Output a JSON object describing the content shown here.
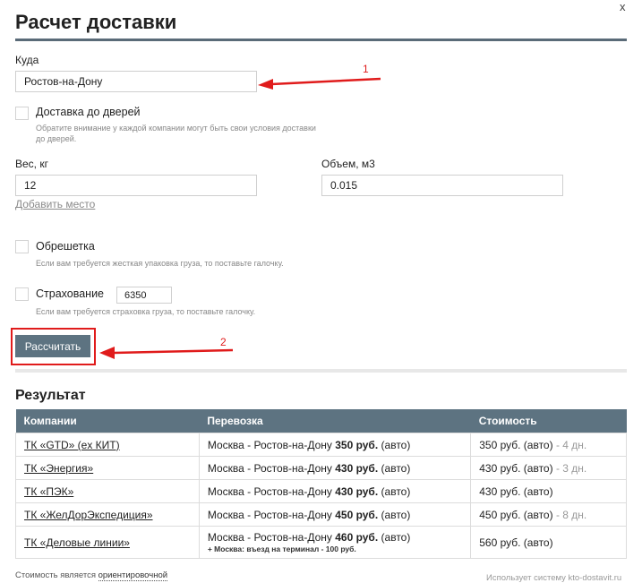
{
  "window": {
    "close_label": "x"
  },
  "title": "Расчет доставки",
  "form": {
    "destination": {
      "label": "Куда",
      "value": "Ростов-на-Дону"
    },
    "door_delivery": {
      "label": "Доставка до дверей",
      "hint_line1": "Обратите внимание у каждой компании могут быть свои условия доставки",
      "hint_line2": "до дверей."
    },
    "weight": {
      "label": "Вес, кг",
      "value": "12"
    },
    "volume": {
      "label": "Объем, м3",
      "value": "0.015"
    },
    "add_place_label": "Добавить место",
    "crate": {
      "label": "Обрешетка",
      "hint": "Если вам требуется жесткая упаковка груза, то поставьте галочку."
    },
    "insurance": {
      "label": "Страхование",
      "value": "6350",
      "hint": "Если вам требуется страховка груза, то поставьте галочку."
    },
    "calculate_label": "Рассчитать"
  },
  "annotations": {
    "arrow1_number": "1",
    "arrow2_number": "2",
    "color": "#e01b1b"
  },
  "result": {
    "title": "Результат",
    "columns": [
      "Компании",
      "Перевозка",
      "Стоимость"
    ],
    "rows": [
      {
        "company": "ТК «GTD» (ex КИТ)",
        "route": "Москва - Ростов-на-Дону",
        "route_price": "350 руб.",
        "route_mode": "(авто)",
        "note": "",
        "cost": "350 руб. (авто)",
        "days": "- 4 дн."
      },
      {
        "company": "ТК «Энергия»",
        "route": "Москва - Ростов-на-Дону",
        "route_price": "430 руб.",
        "route_mode": "(авто)",
        "note": "",
        "cost": "430 руб. (авто)",
        "days": "- 3 дн."
      },
      {
        "company": "ТК «ПЭК»",
        "route": "Москва - Ростов-на-Дону",
        "route_price": "430 руб.",
        "route_mode": "(авто)",
        "note": "",
        "cost": "430 руб. (авто)",
        "days": ""
      },
      {
        "company": "ТК «ЖелДорЭкспедиция»",
        "route": "Москва - Ростов-на-Дону",
        "route_price": "450 руб.",
        "route_mode": "(авто)",
        "note": "",
        "cost": "450 руб. (авто)",
        "days": "- 8 дн."
      },
      {
        "company": "ТК «Деловые линии»",
        "route": "Москва - Ростов-на-Дону",
        "route_price": "460 руб.",
        "route_mode": "(авто)",
        "note": "+ Москва: въезд на терминал - 100 руб.",
        "cost": "560 руб. (авто)",
        "days": ""
      }
    ]
  },
  "footer": {
    "left_text": "Стоимость является",
    "left_link": "ориентировочной",
    "right_text": "Использует систему kto-dostavit.ru"
  },
  "colors": {
    "header_bg": "#5d7381",
    "title_rule": "#5a6b78",
    "annotation_red": "#e01b1b"
  }
}
